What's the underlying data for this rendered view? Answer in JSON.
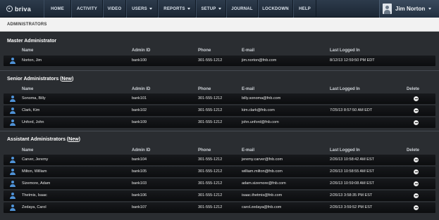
{
  "app": {
    "logo_text": "briva"
  },
  "nav": {
    "home": "HOME",
    "activity": "ACTIVITY",
    "video": "VIDEO",
    "users": "USERS",
    "reports": "REPORTS",
    "setup": "SETUP",
    "journal": "JOURNAL",
    "lockdown": "LOCKDOWN",
    "help": "HELP"
  },
  "user": {
    "name": "Jim Norton"
  },
  "page": {
    "title": "ADMINISTRATORS"
  },
  "columns": {
    "name": "Name",
    "admin_id": "Admin ID",
    "phone": "Phone",
    "email": "E-mail",
    "last": "Last Logged In",
    "delete": "Delete"
  },
  "master": {
    "title": "Master Administrator",
    "rows": [
      {
        "name": "Norton, Jim",
        "id": "bank100",
        "phone": "301-555-1212",
        "email": "jim.norton@fnb.com",
        "last": "8/12/13 12:59:50 PM EDT"
      }
    ]
  },
  "senior": {
    "title": "Senior Administrators",
    "new_link": "New",
    "rows": [
      {
        "name": "Sonoma, Billy",
        "id": "bank101",
        "phone": "301-555-1212",
        "email": "billy.sonoma@fnb.com",
        "last": ""
      },
      {
        "name": "Clark, Kim",
        "id": "bank102",
        "phone": "301-555-1212",
        "email": "kim.clark@fnb.com",
        "last": "7/25/13 8:57:50 AM EDT"
      },
      {
        "name": "Unford, John",
        "id": "bank109",
        "phone": "301-555-1212",
        "email": "john.unford@fnb.com",
        "last": ""
      }
    ]
  },
  "assistant": {
    "title": "Assistant Administrators",
    "new_link": "New",
    "rows": [
      {
        "name": "Carver, Jeremy",
        "id": "bank104",
        "phone": "301-555-1212",
        "email": "jeremy.carver@fnb.com",
        "last": "2/26/13 10:58:42 AM EST"
      },
      {
        "name": "Milton, William",
        "id": "bank105",
        "phone": "301-555-1212",
        "email": "william.milton@fnb.com",
        "last": "2/26/13 10:58:55 AM EST"
      },
      {
        "name": "Sizemore, Adam",
        "id": "bank103",
        "phone": "301-555-1212",
        "email": "adam.sizemore@fnb.com",
        "last": "2/26/13 10:59:08 AM EST"
      },
      {
        "name": "Thetmis, Isaac",
        "id": "bank106",
        "phone": "301-555-1212",
        "email": "isaac.thetmis@fnb.com",
        "last": "2/26/13 3:58:35 PM EST"
      },
      {
        "name": "Zedaya, Carol",
        "id": "bank107",
        "phone": "301-555-1212",
        "email": "carol.zedaya@fnb.com",
        "last": "2/26/13 3:59:52 PM EST"
      }
    ]
  }
}
